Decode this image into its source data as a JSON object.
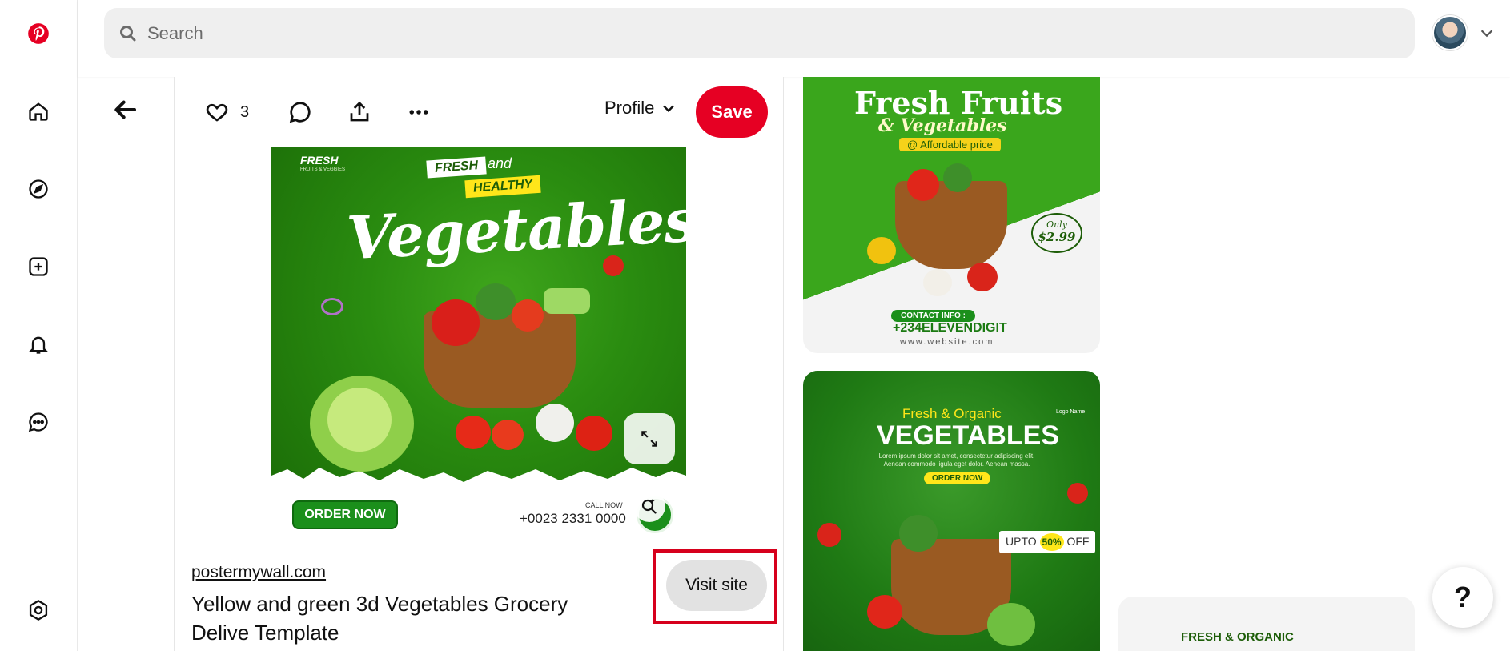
{
  "search": {
    "placeholder": "Search"
  },
  "pin": {
    "like_count": "3",
    "profile_label": "Profile",
    "save_label": "Save",
    "source": "postermywall.com",
    "title": "Yellow and green 3d Vegetables Grocery Delive Template",
    "visit_label": "Visit site",
    "image": {
      "brand": "FRESH",
      "brand_sub": "FRUITS & VEGGIES",
      "tag_fresh": "FRESH",
      "tag_and": "and",
      "tag_healthy": "HEALTHY",
      "headline": "Vegetables",
      "order_now": "ORDER NOW",
      "call_now": "CALL NOW",
      "phone": "+0023 2331 0000"
    }
  },
  "feed": {
    "card1": {
      "title": "Fresh Fruits",
      "subtitle": "& Vegetables",
      "tagline": "@ Affordable price",
      "price_only": "Only",
      "price": "$2.99",
      "contact": "CONTACT INFO :",
      "phone": "+234ELEVENDIGIT",
      "website": "www.website.com"
    },
    "card2": {
      "fresh_organic": "Fresh & Organic",
      "headline": "VEGETABLES",
      "lorem": "Lorem ipsum dolor sit amet, consectetur adipiscing elit. Aenean commodo ligula eget dolor. Aenean massa.",
      "order_now": "ORDER NOW",
      "logo_name": "Logo Name",
      "upto": "UPTO",
      "percent": "50%",
      "off": "OFF"
    },
    "card3": {
      "title": "FRESH & ORGANIC"
    }
  },
  "help_label": "?",
  "colors": {
    "brand_red": "#e60023",
    "highlight": "#d6001c",
    "veg_green": "#2a8c10"
  }
}
